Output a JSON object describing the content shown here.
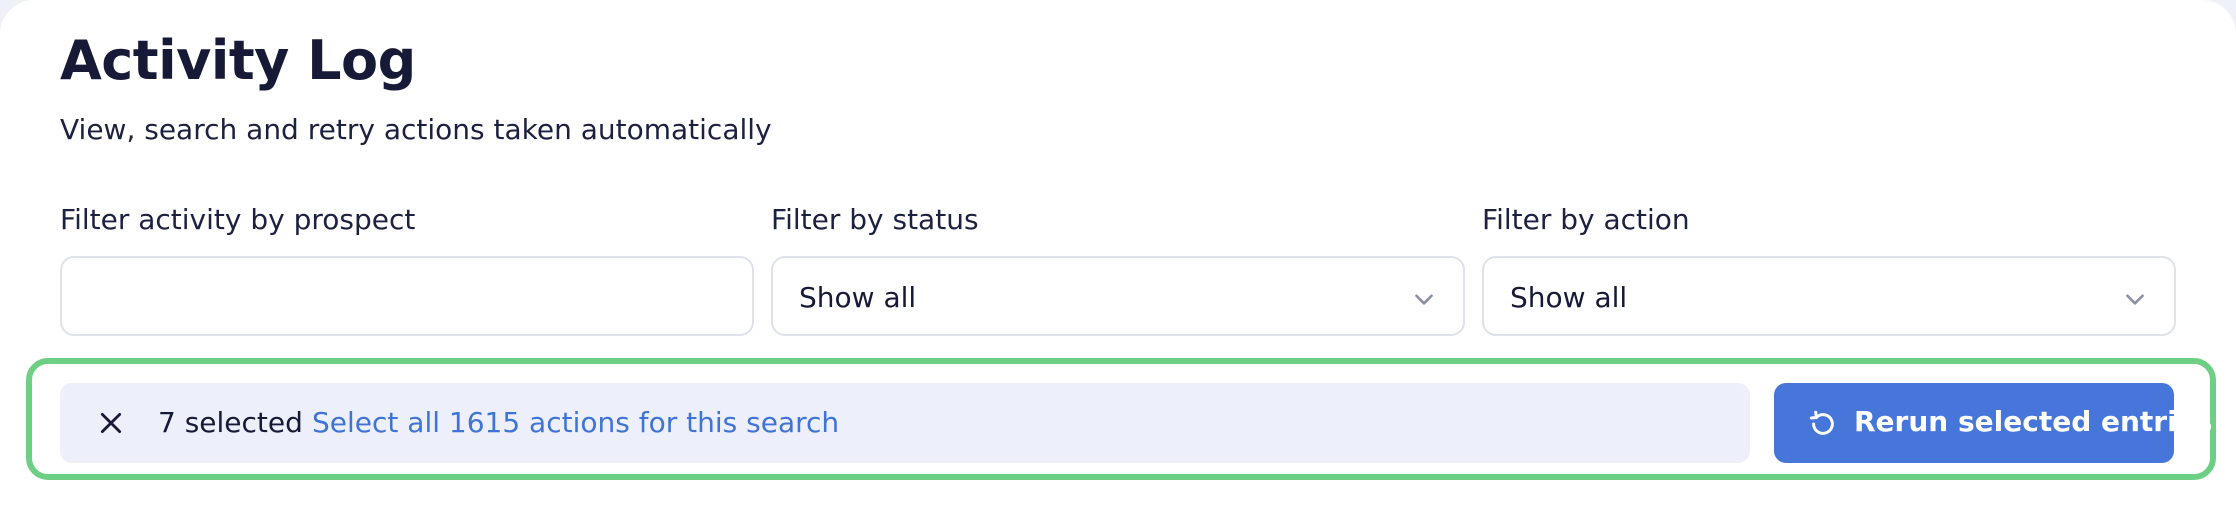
{
  "header": {
    "title": "Activity Log",
    "subtitle": "View, search and retry actions taken automatically"
  },
  "filters": {
    "prospect": {
      "label": "Filter activity by prospect",
      "value": "",
      "placeholder": ""
    },
    "status": {
      "label": "Filter by status",
      "selected": "Show all"
    },
    "action": {
      "label": "Filter by action",
      "selected": "Show all"
    }
  },
  "selection_bar": {
    "selected_text": "7 selected",
    "select_all_link": "Select all 1615 actions for this search",
    "rerun_button": "Rerun selected entries",
    "icons": {
      "clear": "close-icon",
      "rerun": "refresh-icon"
    }
  },
  "colors": {
    "primary": "#4776db",
    "link": "#3f73d6",
    "highlight_frame": "#6ccf83",
    "selection_background": "#edf0fa",
    "text": "#161a36"
  }
}
